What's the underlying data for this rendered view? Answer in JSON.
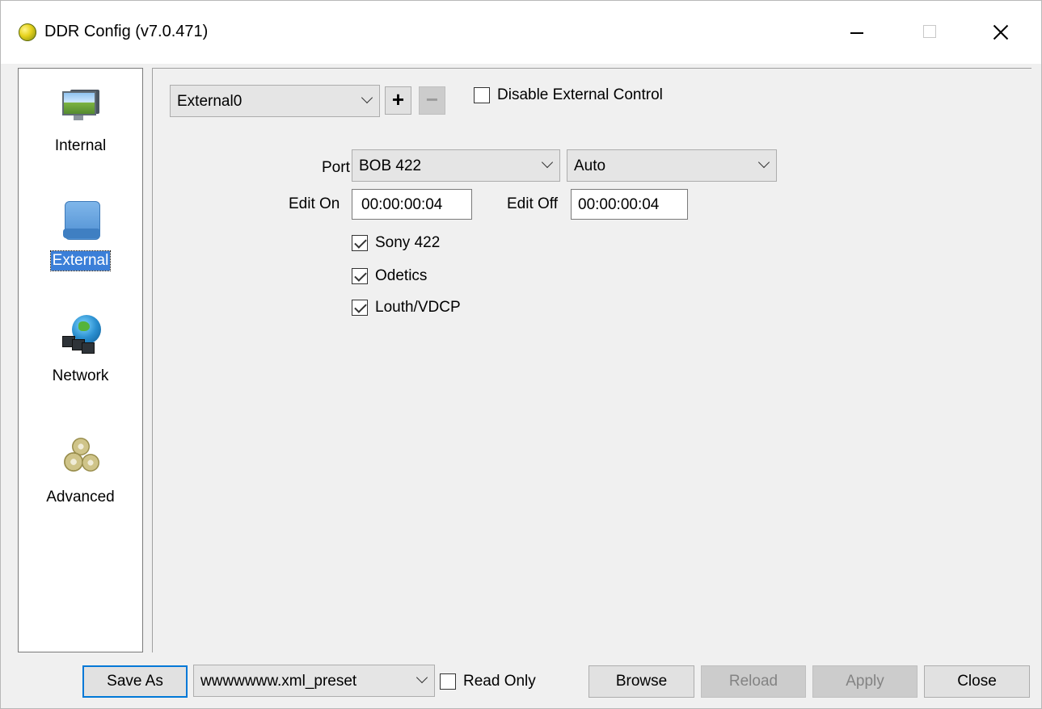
{
  "window": {
    "title": "DDR Config (v7.0.471)"
  },
  "sidebar": {
    "items": [
      {
        "label": "Internal",
        "icon": "monitor-icon",
        "selected": false
      },
      {
        "label": "External",
        "icon": "external-device-icon",
        "selected": true
      },
      {
        "label": "Network",
        "icon": "network-globe-icon",
        "selected": false
      },
      {
        "label": "Advanced",
        "icon": "gears-icon",
        "selected": false
      }
    ]
  },
  "external": {
    "device_select": "External0",
    "add_label": "+",
    "remove_label": "−",
    "disable_external_control": {
      "label": "Disable External Control",
      "checked": false
    },
    "port": {
      "label": "Port",
      "value": "BOB 422",
      "mode": "Auto"
    },
    "edit_on": {
      "label": "Edit On",
      "value": "00:00:00:04"
    },
    "edit_off": {
      "label": "Edit Off",
      "value": "00:00:00:04"
    },
    "protocols": [
      {
        "label": "Sony 422",
        "checked": true
      },
      {
        "label": "Odetics",
        "checked": true
      },
      {
        "label": "Louth/VDCP",
        "checked": true
      }
    ]
  },
  "footer": {
    "save_as": "Save As",
    "preset": "wwwwwww.xml_preset",
    "read_only": {
      "label": "Read Only",
      "checked": false
    },
    "browse": "Browse",
    "reload": "Reload",
    "apply": "Apply",
    "close": "Close"
  }
}
